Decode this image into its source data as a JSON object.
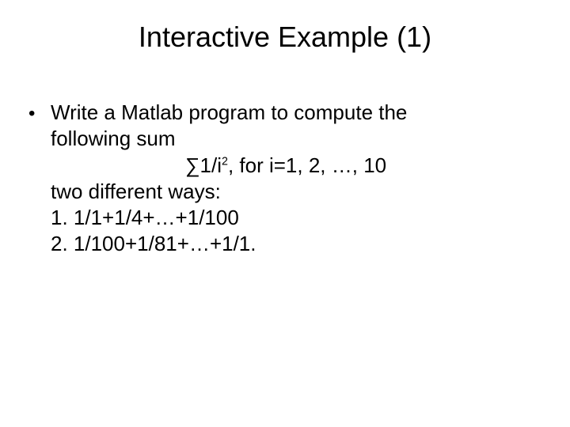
{
  "title": "Interactive Example (1)",
  "body": {
    "lead_line1": "Write a Matlab program to compute the",
    "lead_line2": "following sum",
    "formula_prefix": "∑1/i",
    "formula_exp": "2",
    "formula_suffix": ", for i=1, 2, …, 10",
    "ways_line": "two different ways:",
    "item1": "1.  1/1+1/4+…+1/100",
    "item2": "2.  1/100+1/81+…+1/1."
  }
}
